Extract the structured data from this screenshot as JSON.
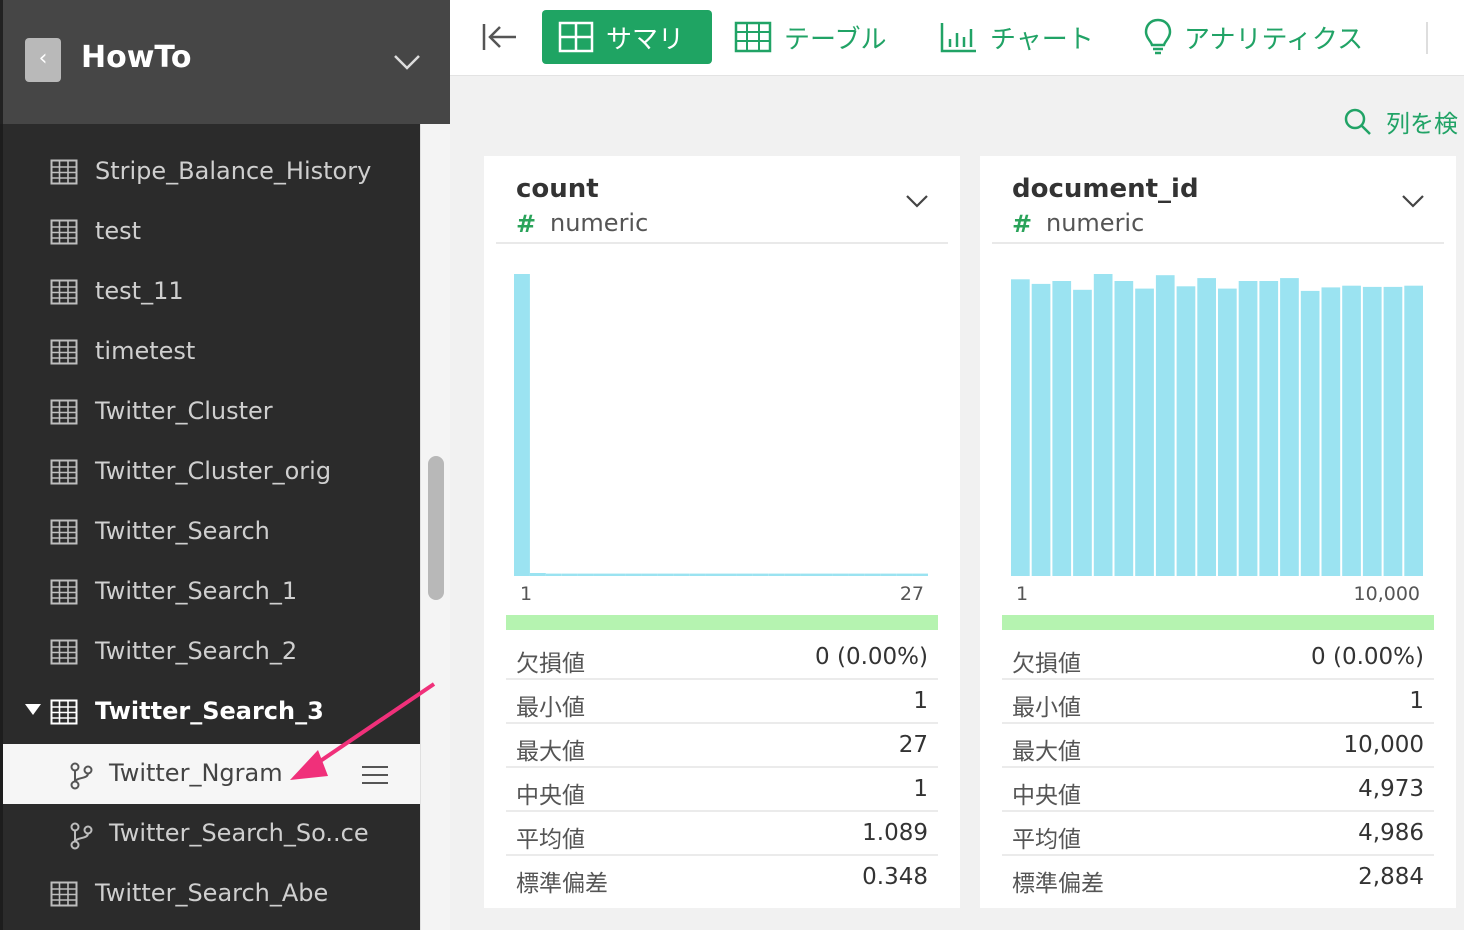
{
  "sidebar": {
    "project_title": "HowTo",
    "back_glyph": "‹",
    "items": [
      {
        "label": "Stripe_Balance_History",
        "icon": "table-icon"
      },
      {
        "label": "test",
        "icon": "table-icon"
      },
      {
        "label": "test_11",
        "icon": "table-icon"
      },
      {
        "label": "timetest",
        "icon": "table-icon"
      },
      {
        "label": "Twitter_Cluster",
        "icon": "table-icon"
      },
      {
        "label": "Twitter_Cluster_orig",
        "icon": "table-icon"
      },
      {
        "label": "Twitter_Search",
        "icon": "table-icon"
      },
      {
        "label": "Twitter_Search_1",
        "icon": "table-icon"
      },
      {
        "label": "Twitter_Search_2",
        "icon": "table-icon"
      },
      {
        "label": "Twitter_Search_3",
        "icon": "table-icon",
        "expanded": true
      },
      {
        "label": "Twitter_Ngram",
        "icon": "branch-icon",
        "child": true,
        "selected": true
      },
      {
        "label": "Twitter_Search_So..ce",
        "icon": "branch-icon",
        "child": true
      },
      {
        "label": "Twitter_Search_Abe",
        "icon": "table-icon"
      }
    ]
  },
  "toolbar": {
    "tabs": {
      "summary": "サマリ",
      "table": "テーブル",
      "chart": "チャート",
      "analytics": "アナリティクス"
    },
    "column_search_label": "列を検"
  },
  "colors": {
    "accent": "#1fa463",
    "histogram_bar": "#9be3f1",
    "valid_bar": "#b5f3b0",
    "sidebar_bg": "#2b2b2b",
    "arrow": "#f0307a"
  },
  "columns": [
    {
      "name": "count",
      "type_mark": "#",
      "type": "numeric",
      "axis_min": "1",
      "axis_max": "27",
      "stats": [
        {
          "label": "欠損値",
          "value": "0 (0.00%)"
        },
        {
          "label": "最小値",
          "value": "1"
        },
        {
          "label": "最大値",
          "value": "27"
        },
        {
          "label": "中央値",
          "value": "1"
        },
        {
          "label": "平均値",
          "value": "1.089"
        },
        {
          "label": "標準偏差",
          "value": "0.348"
        }
      ]
    },
    {
      "name": "document_id",
      "type_mark": "#",
      "type": "numeric",
      "axis_min": "1",
      "axis_max": "10,000",
      "stats": [
        {
          "label": "欠損値",
          "value": "0 (0.00%)"
        },
        {
          "label": "最小値",
          "value": "1"
        },
        {
          "label": "最大値",
          "value": "10,000"
        },
        {
          "label": "中央値",
          "value": "4,973"
        },
        {
          "label": "平均値",
          "value": "4,986"
        },
        {
          "label": "標準偏差",
          "value": "2,884"
        }
      ]
    }
  ],
  "chart_data": [
    {
      "type": "bar",
      "xlabel": "",
      "ylabel": "",
      "x_range": [
        "1",
        "27"
      ],
      "values": [
        1000,
        10,
        8,
        8,
        8,
        8,
        8,
        8,
        8,
        8,
        8,
        8,
        8,
        8,
        8,
        8,
        8,
        8,
        8,
        8,
        8,
        8,
        8,
        8,
        8,
        8
      ],
      "ylim": [
        0,
        1000
      ],
      "grid": false
    },
    {
      "type": "bar",
      "xlabel": "",
      "ylabel": "",
      "x_range": [
        "1",
        "10,000"
      ],
      "values": [
        508,
        500,
        505,
        490,
        517,
        505,
        492,
        515,
        496,
        510,
        492,
        505,
        505,
        510,
        488,
        494,
        497,
        495,
        495,
        497
      ],
      "ylim": [
        0,
        517
      ],
      "grid": false
    }
  ]
}
